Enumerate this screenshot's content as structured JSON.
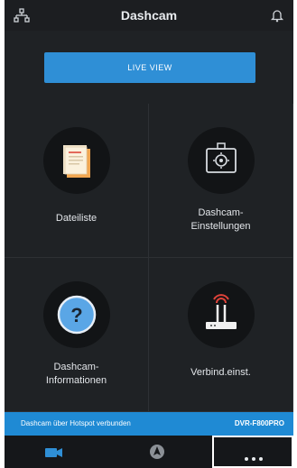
{
  "header": {
    "title": "Dashcam",
    "left_icon": "network-icon",
    "right_icon": "bell-icon"
  },
  "live_view": {
    "label": "LIVE VIEW"
  },
  "tiles": [
    {
      "label_lines": [
        "Dateiliste"
      ],
      "icon": "file-list-icon"
    },
    {
      "label_lines": [
        "Dashcam-",
        "Einstellungen"
      ],
      "icon": "dashcam-settings-icon"
    },
    {
      "label_lines": [
        "Dashcam-",
        "Informationen"
      ],
      "icon": "help-icon"
    },
    {
      "label_lines": [
        "Verbind.einst."
      ],
      "icon": "router-icon"
    }
  ],
  "status": {
    "text": "Dashcam über Hotspot verbunden",
    "device": "DVR-F800PRO"
  },
  "tabs": [
    {
      "icon": "video-camera-icon"
    },
    {
      "icon": "navigation-icon"
    },
    {
      "icon": "more-icon"
    }
  ],
  "colors": {
    "accent": "#2f8fd6",
    "background": "#1f2225"
  }
}
